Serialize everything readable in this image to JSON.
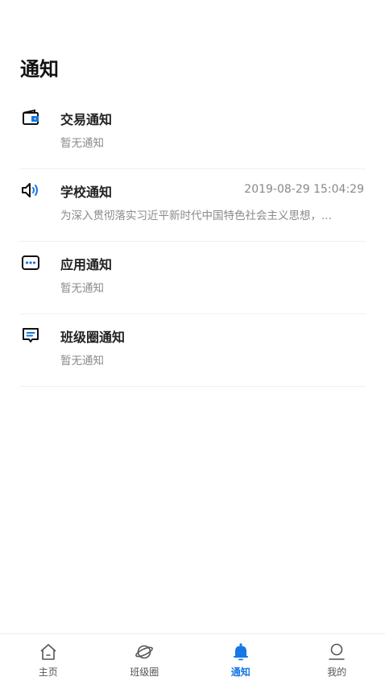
{
  "header": {
    "title": "通知"
  },
  "notices": [
    {
      "icon": "wallet-icon",
      "title": "交易通知",
      "time": "",
      "subtitle": "暂无通知"
    },
    {
      "icon": "speaker-icon",
      "title": "学校通知",
      "time": "2019-08-29 15:04:29",
      "subtitle": "为深入贯彻落实习近平新时代中国特色社会主义思想，..."
    },
    {
      "icon": "more-icon",
      "title": "应用通知",
      "time": "",
      "subtitle": "暂无通知"
    },
    {
      "icon": "chat-icon",
      "title": "班级圈通知",
      "time": "",
      "subtitle": "暂无通知"
    }
  ],
  "tabs": [
    {
      "icon": "home-icon",
      "label": "主页",
      "active": false
    },
    {
      "icon": "planet-icon",
      "label": "班级圈",
      "active": false
    },
    {
      "icon": "bell-icon",
      "label": "通知",
      "active": true
    },
    {
      "icon": "person-icon",
      "label": "我的",
      "active": false
    }
  ],
  "colors": {
    "accent": "#1677e6",
    "text": "#222222",
    "muted": "#8a8a8a"
  }
}
